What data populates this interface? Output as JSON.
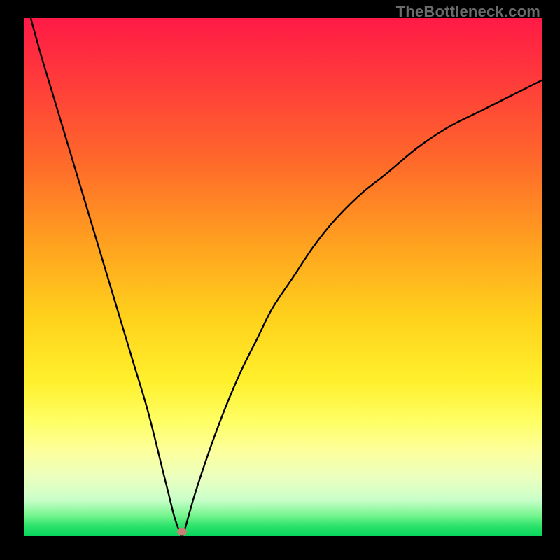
{
  "watermark": {
    "text": "TheBottleneck.com"
  },
  "chart_data": {
    "type": "line",
    "title": "",
    "xlabel": "",
    "ylabel": "",
    "xlim": [
      0,
      100
    ],
    "ylim": [
      0,
      100
    ],
    "grid": false,
    "legend": false,
    "background": "rainbow-gradient-red-to-green",
    "series": [
      {
        "name": "bottleneck-curve",
        "x": [
          0,
          3,
          6,
          9,
          12,
          15,
          18,
          21,
          24,
          27,
          28,
          29,
          30,
          30.5,
          31,
          33,
          36,
          39,
          42,
          45,
          48,
          52,
          56,
          60,
          65,
          70,
          76,
          82,
          88,
          94,
          100
        ],
        "values": [
          105,
          94,
          84,
          74,
          64,
          54,
          44,
          34,
          24,
          12,
          8,
          4,
          1,
          0,
          1,
          8,
          17,
          25,
          32,
          38,
          44,
          50,
          56,
          61,
          66,
          70,
          75,
          79,
          82,
          85,
          88
        ]
      }
    ],
    "marker": {
      "x": 30.5,
      "y": 0.8,
      "color": "#c78177"
    }
  }
}
